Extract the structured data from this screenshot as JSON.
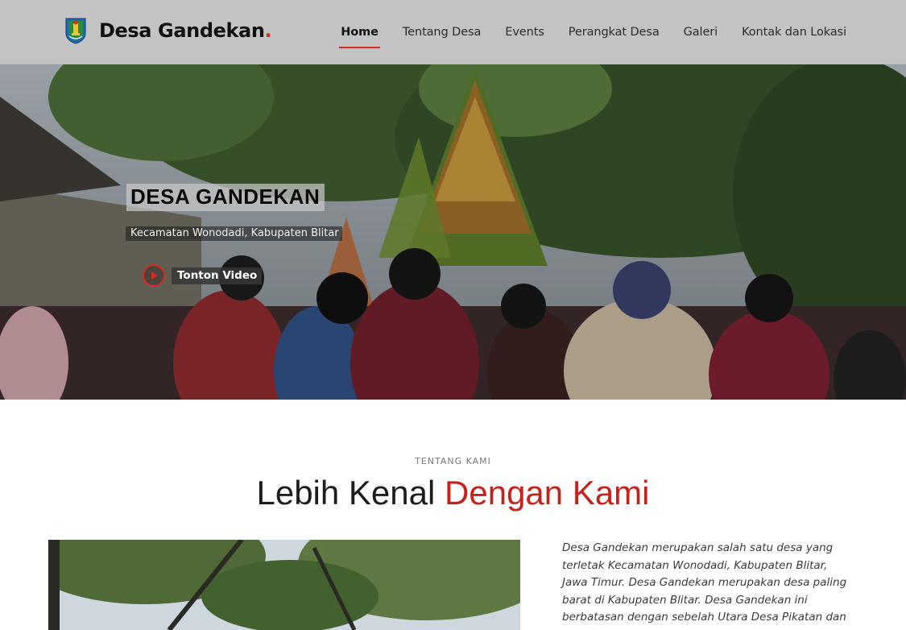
{
  "brand": {
    "name": "Desa Gandekan",
    "dot": ".",
    "accent_color": "#d62b1f"
  },
  "nav": {
    "items": [
      {
        "label": "Home",
        "active": true
      },
      {
        "label": "Tentang Desa",
        "active": false
      },
      {
        "label": "Events",
        "active": false
      },
      {
        "label": "Perangkat Desa",
        "active": false
      },
      {
        "label": "Galeri",
        "active": false
      },
      {
        "label": "Kontak dan Lokasi",
        "active": false
      }
    ]
  },
  "hero": {
    "title": "DESA GANDEKAN",
    "subtitle": "Kecamatan Wonodadi, Kabupaten Blitar",
    "video_label": "Tonton Video",
    "play_icon": "play-circle-icon"
  },
  "about": {
    "eyebrow": "TENTANG KAMI",
    "heading_main": "Lebih Kenal ",
    "heading_accent": "Dengan Kami",
    "paragraph": "Desa Gandekan merupakan salah satu desa yang terletak Kecamatan Wonodadi, Kabupaten Blitar, Jawa Timur. Desa Gandekan merupakan desa paling barat di Kabupaten Blitar. Desa Gandekan ini berbatasan dengan sebelah Utara Desa Pikatan dan Wonodadi (yang"
  }
}
